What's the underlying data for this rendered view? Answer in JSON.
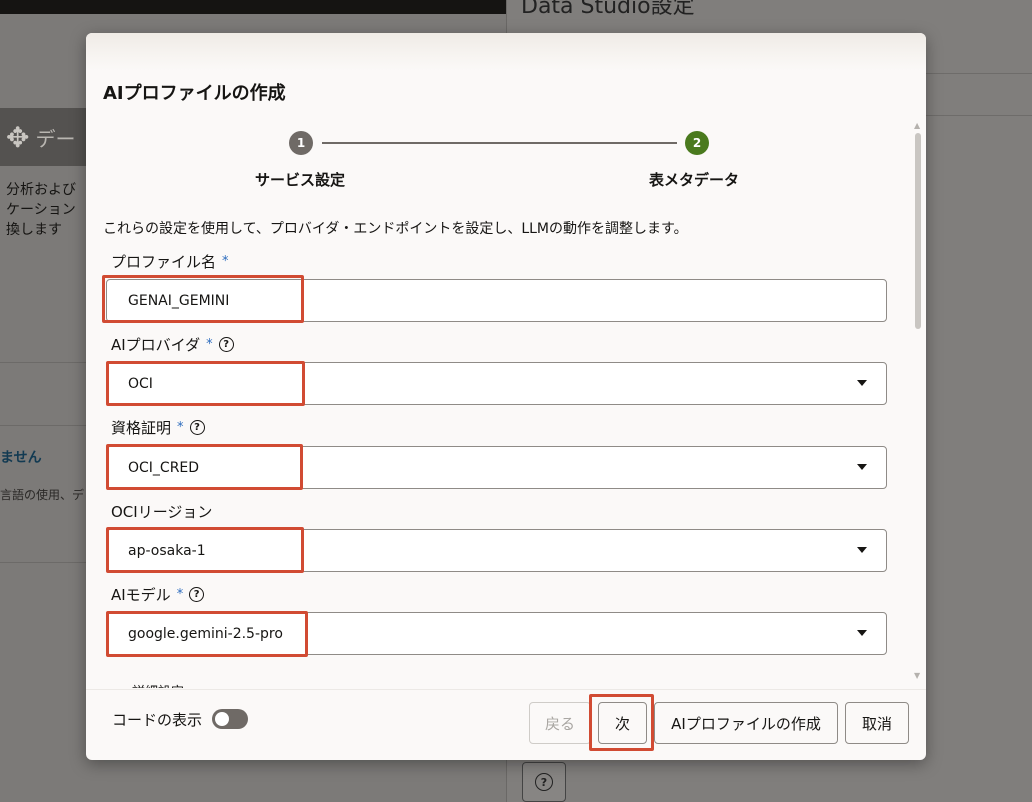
{
  "background": {
    "tile_label": "デー",
    "description": "分析および\nケーション\n換します",
    "warning_title": "ません",
    "warning_desc": "言語の使用、デ",
    "right_panel_title": "Data Studio設定"
  },
  "modal": {
    "title": "AIプロファイルの作成",
    "steps": [
      {
        "number": "1",
        "label": "サービス設定"
      },
      {
        "number": "2",
        "label": "表メタデータ"
      }
    ],
    "intro": "これらの設定を使用して、プロバイダ・エンドポイントを設定し、LLMの動作を調整します。",
    "fields": {
      "profile_name": {
        "label": "プロファイル名",
        "required": "*",
        "value": "GENAI_GEMINI"
      },
      "ai_provider": {
        "label": "AIプロバイダ",
        "required": "*",
        "value": "OCI"
      },
      "credential": {
        "label": "資格証明",
        "required": "*",
        "value": "OCI_CRED"
      },
      "oci_region": {
        "label": "OCIリージョン",
        "value": "ap-osaka-1"
      },
      "ai_model": {
        "label": "AIモデル",
        "required": "*",
        "value": "google.gemini-2.5-pro"
      }
    },
    "cut_label": "詳細設定",
    "footer": {
      "show_code": "コードの表示",
      "back": "戻る",
      "next": "次",
      "create": "AIプロファイルの作成",
      "cancel": "取消"
    }
  },
  "colors": {
    "accent_green": "#4a7a1e",
    "highlight_red": "#d14b33",
    "required_blue": "#2b6bbd"
  }
}
